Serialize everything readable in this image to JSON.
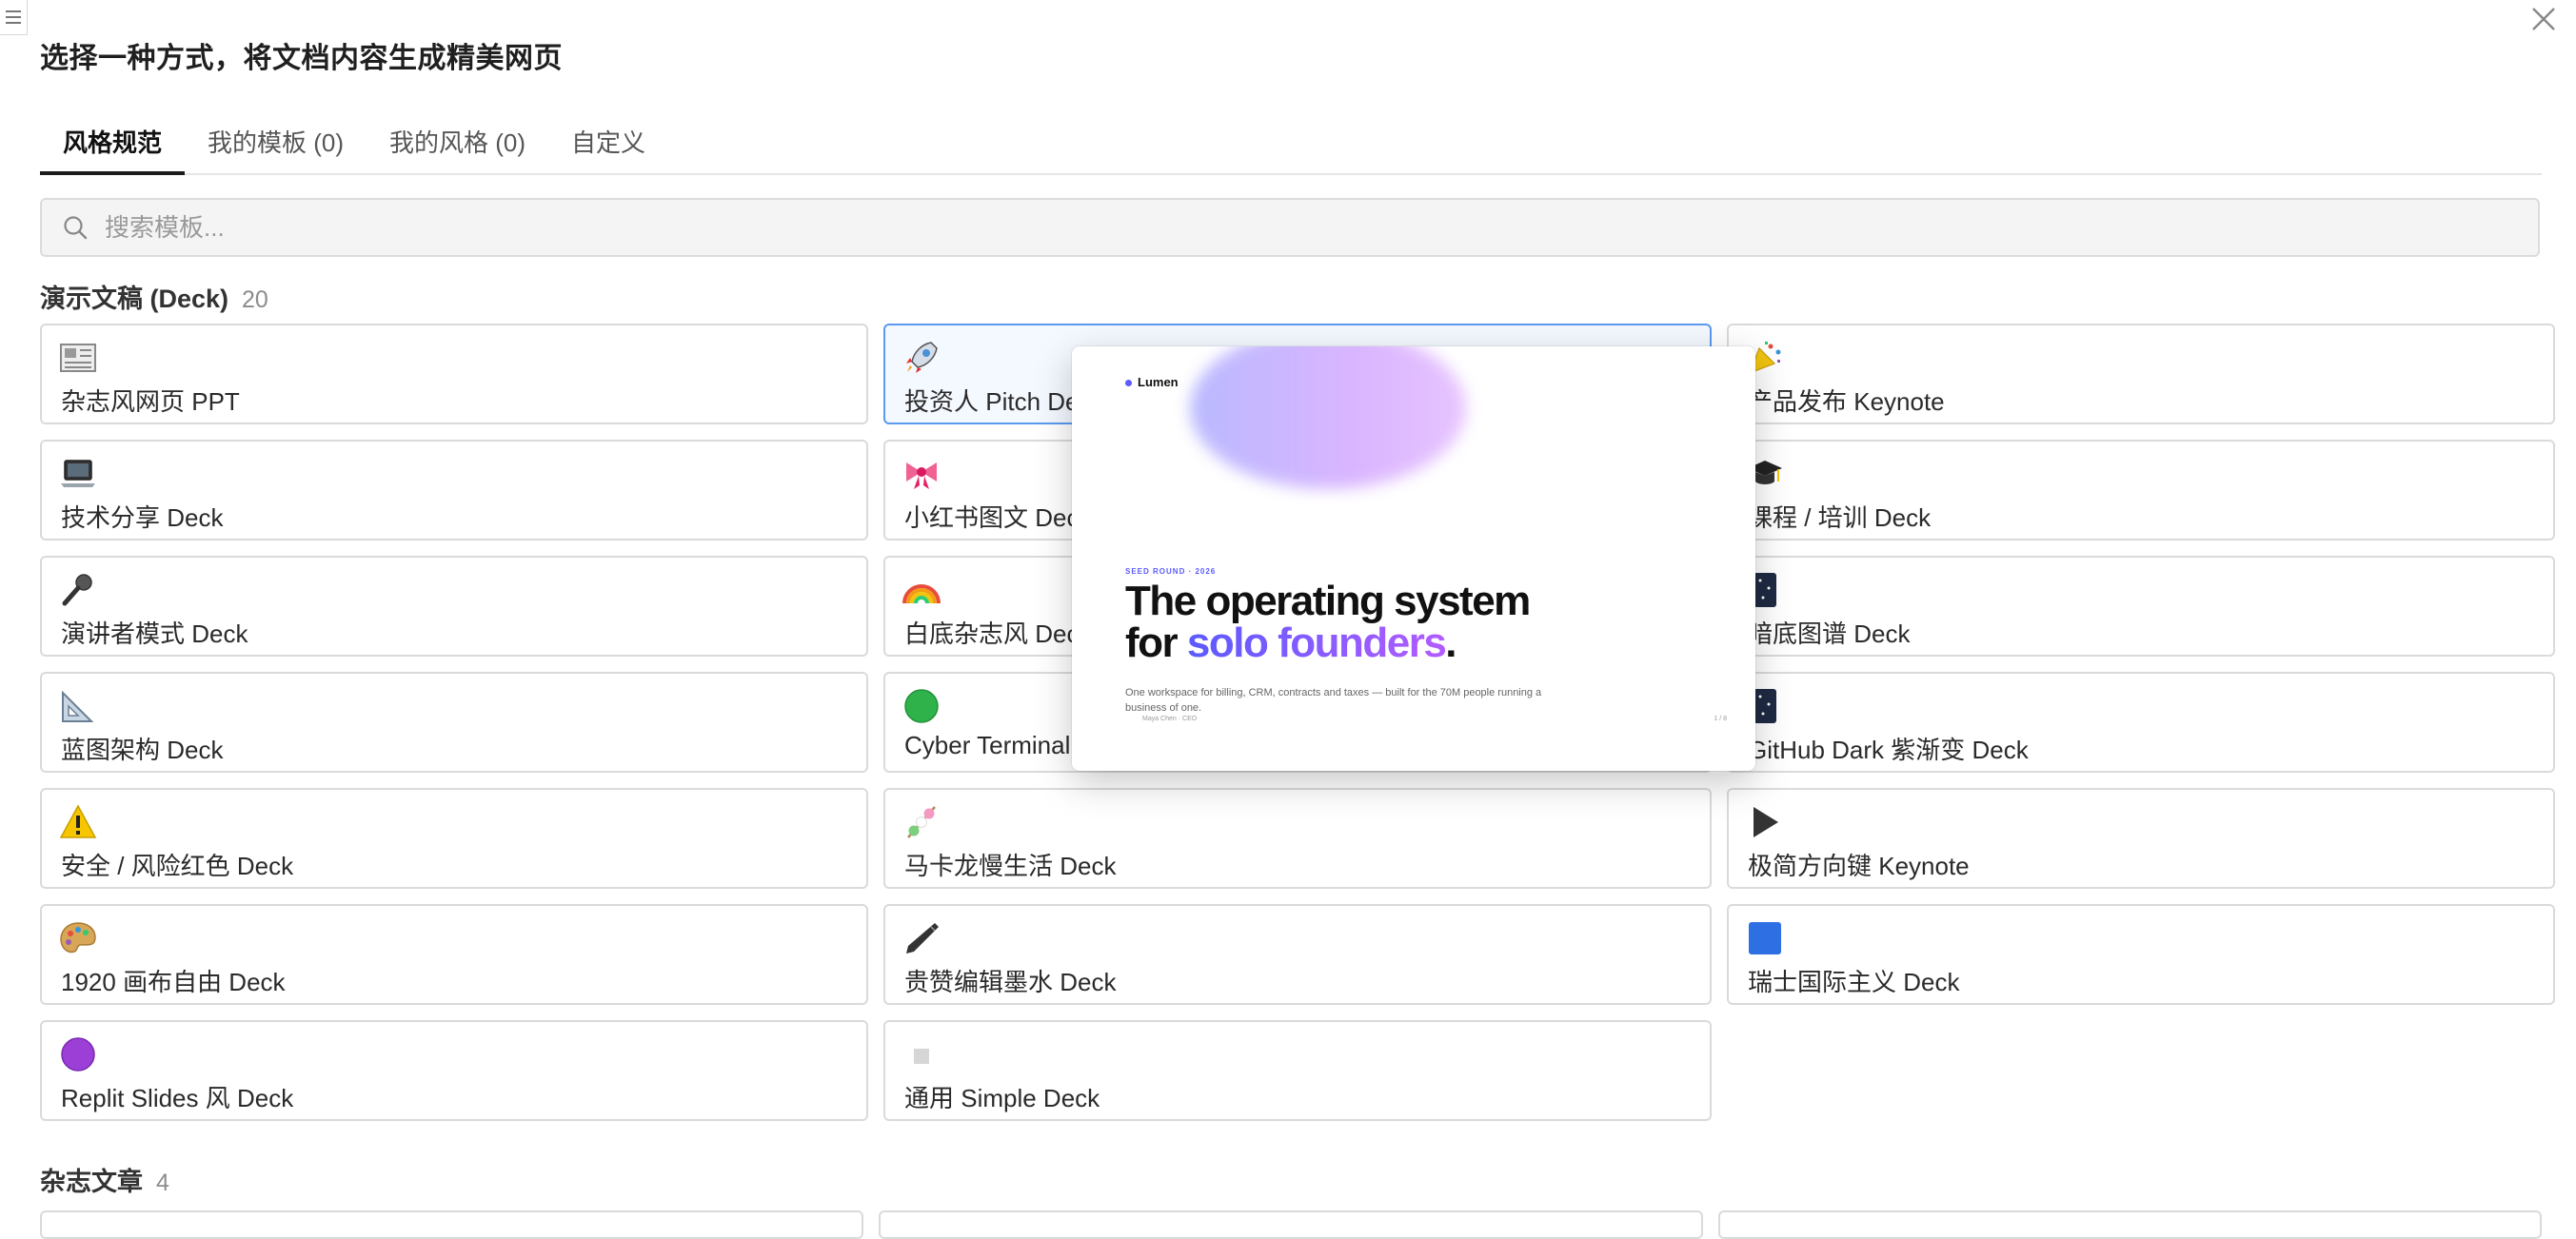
{
  "dialog": {
    "title": "选择一种方式，将文档内容生成精美网页"
  },
  "tabs": [
    {
      "label": "风格规范",
      "active": true
    },
    {
      "label": "我的模板 (0)",
      "active": false
    },
    {
      "label": "我的风格 (0)",
      "active": false
    },
    {
      "label": "自定义",
      "active": false
    }
  ],
  "search": {
    "placeholder": "搜索模板..."
  },
  "sections": [
    {
      "title": "演示文稿 (Deck)",
      "count": "20",
      "cards": [
        {
          "label": "杂志风网页 PPT",
          "icon": "newspaper-icon"
        },
        {
          "label": "投资人 Pitch Deck",
          "icon": "rocket-icon",
          "selected": true
        },
        {
          "label": "产品发布 Keynote",
          "icon": "party-popper-icon"
        },
        {
          "label": "技术分享 Deck",
          "icon": "laptop-icon"
        },
        {
          "label": "小红书图文 Deck",
          "icon": "ribbon-icon"
        },
        {
          "label": "课程 / 培训 Deck",
          "icon": "graduation-cap-icon"
        },
        {
          "label": "演讲者模式 Deck",
          "icon": "microphone-icon"
        },
        {
          "label": "白底杂志风 Deck",
          "icon": "rainbow-icon"
        },
        {
          "label": "暗底图谱 Deck",
          "icon": "night-sky-icon"
        },
        {
          "label": "蓝图架构 Deck",
          "icon": "triangular-ruler-icon"
        },
        {
          "label": "Cyber Terminal Deck",
          "icon": "green-circle-icon"
        },
        {
          "label": "GitHub Dark 紫渐变 Deck",
          "icon": "night-sky-icon"
        },
        {
          "label": "安全 / 风险红色 Deck",
          "icon": "warning-icon"
        },
        {
          "label": "马卡龙慢生活 Deck",
          "icon": "dango-icon"
        },
        {
          "label": "极简方向键 Keynote",
          "icon": "play-icon"
        },
        {
          "label": "1920 画布自由 Deck",
          "icon": "palette-icon"
        },
        {
          "label": "贵赞编辑墨水 Deck",
          "icon": "pen-icon"
        },
        {
          "label": "瑞士国际主义 Deck",
          "icon": "blue-square-icon"
        },
        {
          "label": "Replit Slides 风 Deck",
          "icon": "purple-circle-icon"
        },
        {
          "label": "通用 Simple Deck",
          "icon": "white-square-icon"
        }
      ]
    },
    {
      "title": "杂志文章",
      "count": "4"
    }
  ],
  "preview": {
    "brand": "Lumen",
    "kicker": "SEED ROUND · 2026",
    "headline_line1": "The operating system",
    "headline_for": "for ",
    "headline_accent": "solo founders",
    "headline_period": ".",
    "subtitle": "One workspace for billing, CRM, contracts and taxes — built for the 70M people running a business of one.",
    "footer_left": "Maya Chen · CEO",
    "footer_right": "1 / 8"
  },
  "colors": {
    "selected_border": "#5a9af0",
    "accent_purple": "#5b5bff",
    "accent_violet": "#b25cff"
  }
}
